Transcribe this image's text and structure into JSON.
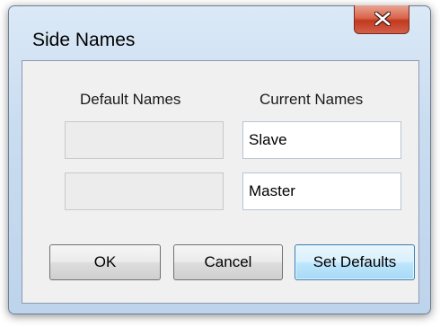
{
  "window": {
    "title": "Side Names",
    "close_glyph": "X"
  },
  "columns": {
    "default_header": "Default Names",
    "current_header": "Current Names"
  },
  "rows": [
    {
      "default_value": "",
      "current_value": "Slave"
    },
    {
      "default_value": "",
      "current_value": "Master"
    }
  ],
  "buttons": {
    "ok": "OK",
    "cancel": "Cancel",
    "set_defaults": "Set Defaults"
  }
}
